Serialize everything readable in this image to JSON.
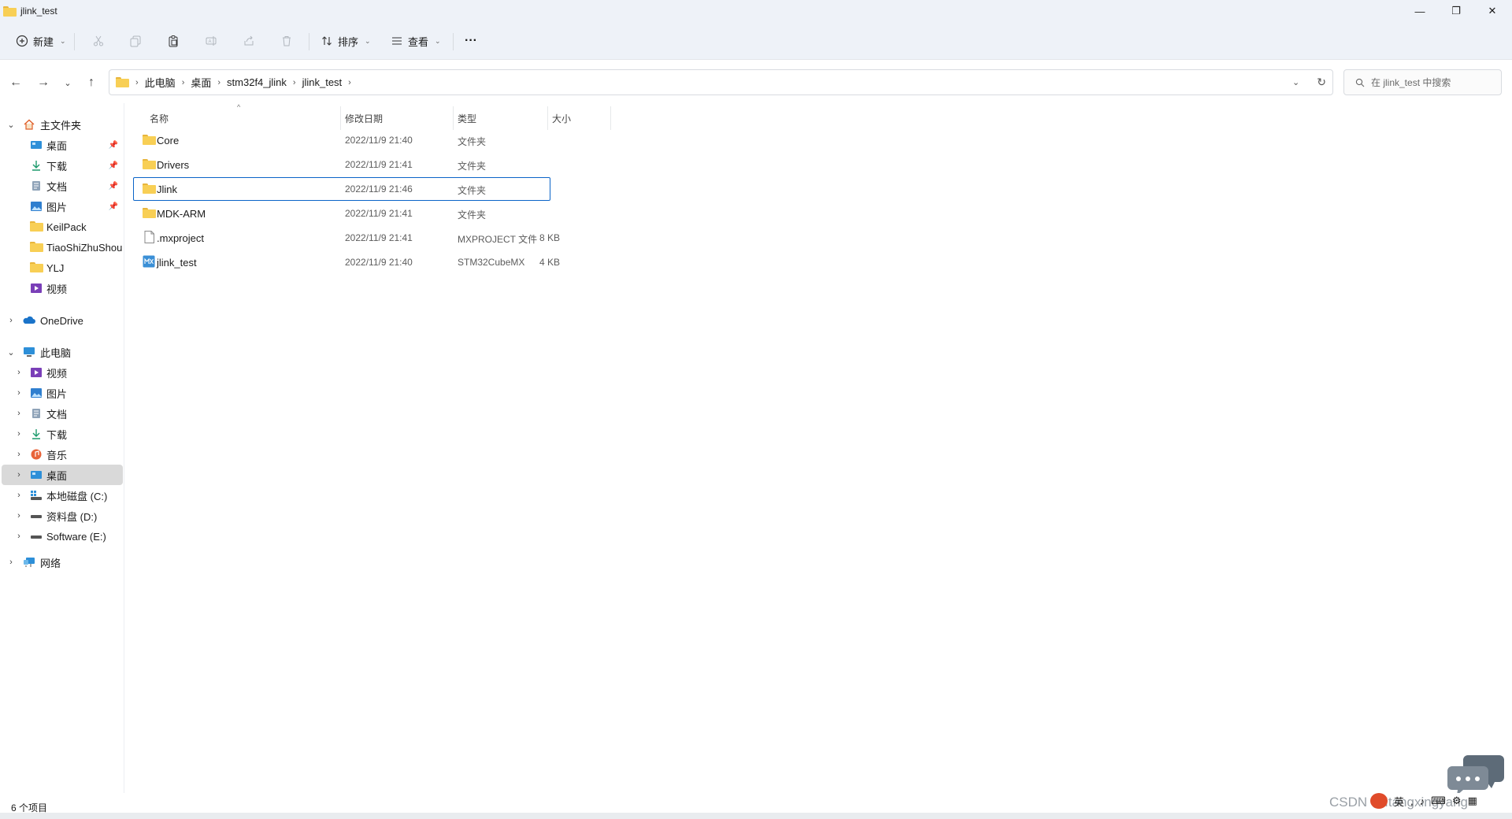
{
  "window": {
    "title": "jlink_test",
    "minimize": "—",
    "restore": "❐",
    "close": "✕"
  },
  "commandbar": {
    "new_label": "新建",
    "sort_label": "排序",
    "view_label": "查看",
    "more_label": "···"
  },
  "address": {
    "breadcrumbs": [
      "此电脑",
      "桌面",
      "stm32f4_jlink",
      "jlink_test"
    ],
    "search_placeholder": "在 jlink_test 中搜索"
  },
  "sidebar": {
    "items": [
      {
        "label": "主文件夹",
        "icon": "home-icon",
        "pinned": false
      },
      {
        "label": "桌面",
        "icon": "desktop-icon",
        "pinned": true
      },
      {
        "label": "下载",
        "icon": "download-icon",
        "pinned": true
      },
      {
        "label": "文档",
        "icon": "document-icon",
        "pinned": true
      },
      {
        "label": "图片",
        "icon": "pictures-icon",
        "pinned": true
      },
      {
        "label": "KeilPack",
        "icon": "folder-icon",
        "pinned": false
      },
      {
        "label": "TiaoShiZhuShou",
        "icon": "folder-icon",
        "pinned": false
      },
      {
        "label": "YLJ",
        "icon": "folder-icon",
        "pinned": false
      },
      {
        "label": "视频",
        "icon": "videos-icon",
        "pinned": false
      },
      {
        "label": "OneDrive",
        "icon": "onedrive-icon",
        "pinned": false
      },
      {
        "label": "此电脑",
        "icon": "this-pc-icon",
        "pinned": false
      },
      {
        "label": "视频",
        "icon": "videos-icon",
        "pinned": false
      },
      {
        "label": "图片",
        "icon": "pictures-icon",
        "pinned": false
      },
      {
        "label": "文档",
        "icon": "document-icon",
        "pinned": false
      },
      {
        "label": "下载",
        "icon": "download-icon",
        "pinned": false
      },
      {
        "label": "音乐",
        "icon": "music-icon",
        "pinned": false
      },
      {
        "label": "桌面",
        "icon": "desktop-icon",
        "pinned": false
      },
      {
        "label": "本地磁盘 (C:)",
        "icon": "local-disk-icon",
        "pinned": false
      },
      {
        "label": "资料盘 (D:)",
        "icon": "drive-icon",
        "pinned": false
      },
      {
        "label": "Software (E:)",
        "icon": "drive-icon",
        "pinned": false
      },
      {
        "label": "网络",
        "icon": "network-icon",
        "pinned": false
      }
    ]
  },
  "filelist": {
    "columns": {
      "name": "名称",
      "date": "修改日期",
      "type": "类型",
      "size": "大小"
    },
    "files": [
      {
        "name": "Core",
        "date": "2022/11/9 21:40",
        "type": "文件夹",
        "size": "",
        "icon": "folder-icon"
      },
      {
        "name": "Drivers",
        "date": "2022/11/9 21:41",
        "type": "文件夹",
        "size": "",
        "icon": "folder-icon"
      },
      {
        "name": "Jlink",
        "date": "2022/11/9 21:46",
        "type": "文件夹",
        "size": "",
        "icon": "folder-icon"
      },
      {
        "name": "MDK-ARM",
        "date": "2022/11/9 21:41",
        "type": "文件夹",
        "size": "",
        "icon": "folder-icon"
      },
      {
        "name": ".mxproject",
        "date": "2022/11/9 21:41",
        "type": "MXPROJECT 文件",
        "size": "8 KB",
        "icon": "file-icon"
      },
      {
        "name": "jlink_test",
        "date": "2022/11/9 21:40",
        "type": "STM32CubeMX",
        "size": "4 KB",
        "icon": "cubemx-icon"
      }
    ]
  },
  "status": {
    "item_count": "6 个项目"
  },
  "overlay": {
    "watermark": "CSDN @Itangxingyang",
    "ime_lang": "英"
  }
}
